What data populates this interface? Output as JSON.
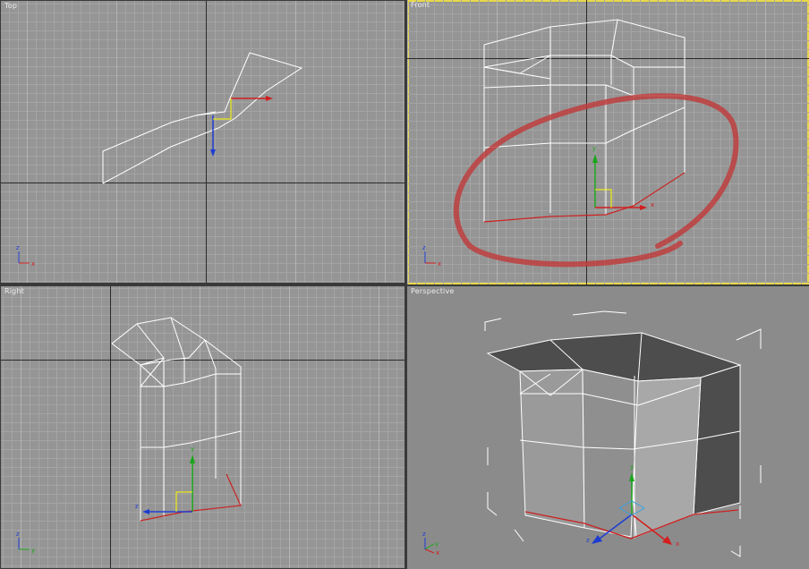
{
  "viewports": {
    "top": {
      "label": "Top",
      "active": false
    },
    "front": {
      "label": "Front",
      "active": true
    },
    "right": {
      "label": "Right",
      "active": false
    },
    "perspective": {
      "label": "Perspective",
      "active": false
    }
  },
  "axis_labels": {
    "x": "x",
    "y": "y",
    "z": "z"
  },
  "colors": {
    "viewport_bg": "#959595",
    "grid_minor": "#a4a4a4",
    "grid_major": "#2a2a2a",
    "wire": "#ffffff",
    "selected_edge": "#cc2222",
    "gizmo_x": "#d21e1e",
    "gizmo_y": "#1aa61a",
    "gizmo_z": "#1e3cd2",
    "active_border": "#e8d84a",
    "annotation_circle": "#c03a3a",
    "shaded_dark": "#4d4d4d",
    "shaded_mid": "#7a7a7a",
    "shaded_light": "#a8a8a8"
  }
}
